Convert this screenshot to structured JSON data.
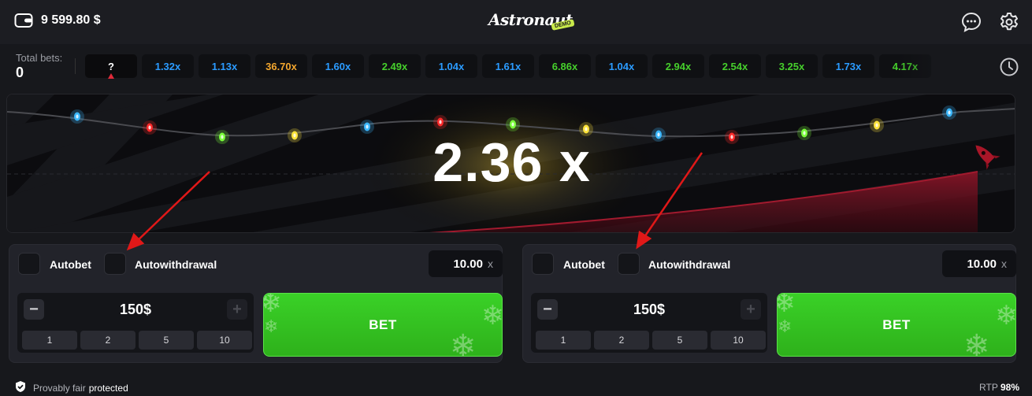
{
  "header": {
    "balance": "9 599.80 $",
    "logo_text": "Astronaut",
    "logo_badge": "DEMO"
  },
  "history": {
    "total_label": "Total bets:",
    "total_value": "0",
    "current": "?",
    "multipliers": [
      {
        "value": "1.32x",
        "color": "#2b9bff"
      },
      {
        "value": "1.13x",
        "color": "#2b9bff"
      },
      {
        "value": "36.70x",
        "color": "#f2a62e"
      },
      {
        "value": "1.60x",
        "color": "#2b9bff"
      },
      {
        "value": "2.49x",
        "color": "#46cf2c"
      },
      {
        "value": "1.04x",
        "color": "#2b9bff"
      },
      {
        "value": "1.61x",
        "color": "#2b9bff"
      },
      {
        "value": "6.86x",
        "color": "#46cf2c"
      },
      {
        "value": "1.04x",
        "color": "#2b9bff"
      },
      {
        "value": "2.94x",
        "color": "#46cf2c"
      },
      {
        "value": "2.54x",
        "color": "#46cf2c"
      },
      {
        "value": "3.25x",
        "color": "#46cf2c"
      },
      {
        "value": "1.73x",
        "color": "#2b9bff"
      },
      {
        "value": "4.17x",
        "color": "#46cf2c"
      }
    ]
  },
  "game": {
    "multiplier": "2.36 x"
  },
  "panels": [
    {
      "autobet_label": "Autobet",
      "autowithdrawal_label": "Autowithdrawal",
      "auto_value": "10.00",
      "auto_suffix": "x",
      "amount": "150$",
      "minus": "−",
      "plus": "+",
      "quick": [
        "1",
        "2",
        "5",
        "10"
      ],
      "bet_label": "BET"
    },
    {
      "autobet_label": "Autobet",
      "autowithdrawal_label": "Autowithdrawal",
      "auto_value": "10.00",
      "auto_suffix": "x",
      "amount": "150$",
      "minus": "−",
      "plus": "+",
      "quick": [
        "1",
        "2",
        "5",
        "10"
      ],
      "bet_label": "BET"
    }
  ],
  "footer": {
    "provably_fair": "Provably fair",
    "protected": "protected",
    "rtp_label": "RTP",
    "rtp_value": "98%"
  },
  "colors": {
    "accent_green": "#34c321",
    "low_multiplier": "#2b9bff",
    "mid_multiplier": "#46cf2c",
    "high_multiplier": "#f2a62e",
    "curve": "#7a0f1f"
  }
}
